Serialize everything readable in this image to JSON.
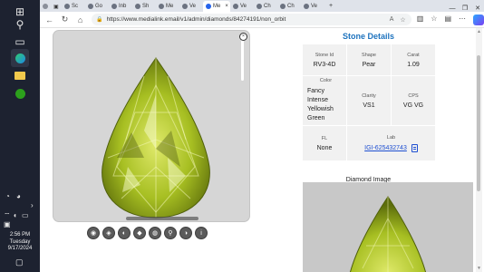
{
  "taskbar": {
    "clock": {
      "time": "2:56 PM",
      "day": "Tuesday",
      "date": "9/17/2024"
    }
  },
  "browser": {
    "tabs": [
      {
        "label": "Sc"
      },
      {
        "label": "Go"
      },
      {
        "label": "Inb"
      },
      {
        "label": "Sh"
      },
      {
        "label": "Me"
      },
      {
        "label": "Ve"
      },
      {
        "label": "Me",
        "active": true
      },
      {
        "label": "Ve"
      },
      {
        "label": "Ch"
      },
      {
        "label": "Ch"
      },
      {
        "label": "Ve"
      }
    ],
    "url": "https://www.medialink.email/v1/admin/diamonds/84274191/non_orbit",
    "new_tab": "+"
  },
  "viewer": {
    "close_label": "×",
    "tools": [
      {
        "icon": "gem-icon",
        "glyph": "◉"
      },
      {
        "icon": "gem-side-icon",
        "glyph": "◈"
      },
      {
        "icon": "gem-profile-icon",
        "glyph": "◐"
      },
      {
        "icon": "gem-facet-icon",
        "glyph": "◆"
      },
      {
        "icon": "gem-angle-icon",
        "glyph": "◍"
      },
      {
        "icon": "zoom-icon",
        "glyph": "⚲"
      },
      {
        "icon": "contrast-icon",
        "glyph": "◑"
      },
      {
        "icon": "info-icon",
        "glyph": "i"
      }
    ]
  },
  "details": {
    "title": "Stone Details",
    "stone_id": {
      "label": "Stone Id",
      "value": "RV3-4D"
    },
    "shape": {
      "label": "Shape",
      "value": "Pear"
    },
    "carat": {
      "label": "Carat",
      "value": "1.09"
    },
    "color": {
      "label": "Color",
      "value_lines": [
        "Fancy",
        "Intense",
        "Yellowish",
        "Green"
      ]
    },
    "clarity": {
      "label": "Clarity",
      "value": "VS1"
    },
    "cps": {
      "label": "CPS",
      "value": "VG VG"
    },
    "fl": {
      "label": "FL",
      "value": "None"
    },
    "lab": {
      "label": "Lab",
      "value": "IGI-625432743"
    },
    "diamond_image_label": "Diamond Image"
  },
  "colors": {
    "accent": "#1e73be",
    "link": "#1e4fd1",
    "gem": "#b7cf2a"
  }
}
